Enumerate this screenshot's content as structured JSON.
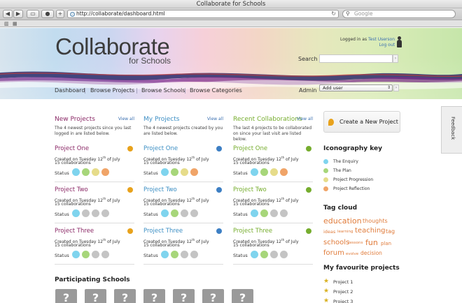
{
  "browser": {
    "title": "Collaborate for Schools",
    "url": "http://collaborate/dashboard.html",
    "search_placeholder": "Google"
  },
  "header": {
    "logo_text": "Collaborate",
    "logo_sub": "for Schools",
    "logged_in_prefix": "Logged in as",
    "user_name": "Test Userson",
    "logout_label": "Log out",
    "search_label": "Search",
    "search_go": "›",
    "admin_label": "Admin",
    "admin_selected": "Add user"
  },
  "nav": {
    "items": [
      "Dashboard",
      "Browse Projects",
      "Browse Schools",
      "Browse Categories"
    ],
    "separator": "|"
  },
  "colors": {
    "new_projects": "#8b2a67",
    "my_projects": "#3d8fc4",
    "recent": "#76ad2e",
    "link": "#3a6fb0",
    "enquiry": "#7fd4ee",
    "plan": "#a7d67a",
    "progression": "#e6dc8a",
    "reflection": "#f0a468",
    "empty": "#c4c4c4",
    "tag": "#e07b3a"
  },
  "columns": [
    {
      "title": "New Projects",
      "view_all": "View all",
      "description": "The 4 newest projects since you last logged in are listed below.",
      "icon": "lightbulb-icon",
      "projects": [
        {
          "title": "Project One",
          "created": "Created on Tuesday 12th of July",
          "count": "15 collaborations",
          "status_label": "Status",
          "status": [
            "enquiry",
            "plan",
            "progression",
            "reflection"
          ]
        },
        {
          "title": "Project Two",
          "created": "Created on Tuesday 12th of July",
          "count": "15 collaborations",
          "status_label": "Status",
          "status": [
            "enquiry",
            "empty",
            "empty",
            "empty"
          ]
        },
        {
          "title": "Project Three",
          "created": "Created on Tuesday 12th of July",
          "count": "15 collaborations",
          "status_label": "Status",
          "status": [
            "enquiry",
            "plan",
            "empty",
            "empty"
          ]
        }
      ]
    },
    {
      "title": "My Projects",
      "view_all": "View all",
      "description": "The 4 newest projects created by you are listed below.",
      "icon": "chat-bubble-icon",
      "projects": [
        {
          "title": "Project One",
          "created": "Created on Tuesday 12th of July",
          "count": "15 collaborations",
          "status_label": "Status",
          "status": [
            "enquiry",
            "plan",
            "progression",
            "reflection"
          ]
        },
        {
          "title": "Project Two",
          "created": "Created on Tuesday 12th of July",
          "count": "15 collaborations",
          "status_label": "Status",
          "status": [
            "enquiry",
            "plan",
            "empty",
            "empty"
          ]
        },
        {
          "title": "Project Three",
          "created": "Created on Tuesday 12th of July",
          "count": "15 collaborations",
          "status_label": "Status",
          "status": [
            "enquiry",
            "plan",
            "empty",
            "empty"
          ]
        }
      ]
    },
    {
      "title": "Recent Collaborations",
      "view_all": "View all",
      "description": "The last 4 projects to be collaborated on since your last visit are listed below.",
      "icon": "speech-bubble-icon",
      "projects": [
        {
          "title": "Project One",
          "created": "Created on Tuesday 12th of July",
          "count": "15 collaborations",
          "status_label": "Status",
          "status": [
            "enquiry",
            "plan",
            "progression",
            "reflection"
          ]
        },
        {
          "title": "Project Two",
          "created": "Created on Tuesday 12th of July",
          "count": "15 collaborations",
          "status_label": "Status",
          "status": [
            "enquiry",
            "plan",
            "empty",
            "empty"
          ]
        },
        {
          "title": "Project Three",
          "created": "Created on Tuesday 12th of July",
          "count": "15 collaborations",
          "status_label": "Status",
          "status": [
            "enquiry",
            "plan",
            "empty",
            "empty"
          ]
        }
      ]
    }
  ],
  "sidebar": {
    "create_label": "Create a New Project",
    "feedback_label": "Feedback",
    "icon_key_title": "Iconography key",
    "icon_key": [
      {
        "label": "The Enquiry",
        "color": "#7fd4ee"
      },
      {
        "label": "The Plan",
        "color": "#a7d67a"
      },
      {
        "label": "Project Progression",
        "color": "#e6dc8a"
      },
      {
        "label": "Project Reflection",
        "color": "#f0a468"
      }
    ],
    "tag_cloud_title": "Tag cloud",
    "tags": [
      "education",
      "thoughts",
      "ideas",
      "learning",
      "teaching",
      "tag",
      "schools",
      "lessons",
      "fun",
      "plan",
      "forum",
      "evolve",
      "decision"
    ],
    "favourites_title": "My favourite projects",
    "favourites": [
      "Project 1",
      "Project 2",
      "Project 3"
    ]
  },
  "schools": {
    "title": "Participating Schools",
    "placeholder": "?",
    "count": 7
  }
}
